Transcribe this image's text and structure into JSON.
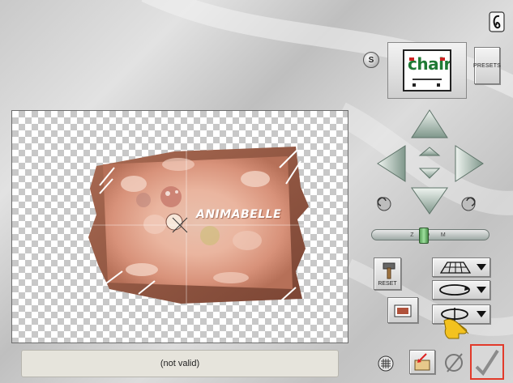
{
  "status": {
    "text": "(not valid)"
  },
  "preview": {
    "watermark_text": "ANIMABELLE"
  },
  "thumbnail": {
    "text": "chair"
  },
  "buttons": {
    "presets_label": "PRESETS",
    "reset_label": "RESET",
    "s_badge": "S"
  },
  "slider": {
    "label": "Z O M"
  },
  "icons": [
    "help-icon",
    "s-badge-icon",
    "arrow-up-icon",
    "arrow-down-icon",
    "arrow-left-icon",
    "arrow-right-icon",
    "rotate-left-icon",
    "rotate-right-icon",
    "hammer-icon",
    "mesh-grid-icon",
    "rotate-ellipse-icon",
    "rotate-vertical-icon",
    "grid-icon",
    "open-file-icon",
    "cancel-icon",
    "checkmark-icon",
    "pointing-hand-icon"
  ],
  "colors": {
    "ok_highlight": "#e23a2a",
    "frame_brown": "#9a5a44",
    "frame_peach": "#e8b4a0",
    "arrow_green": "#9fb5a8"
  }
}
